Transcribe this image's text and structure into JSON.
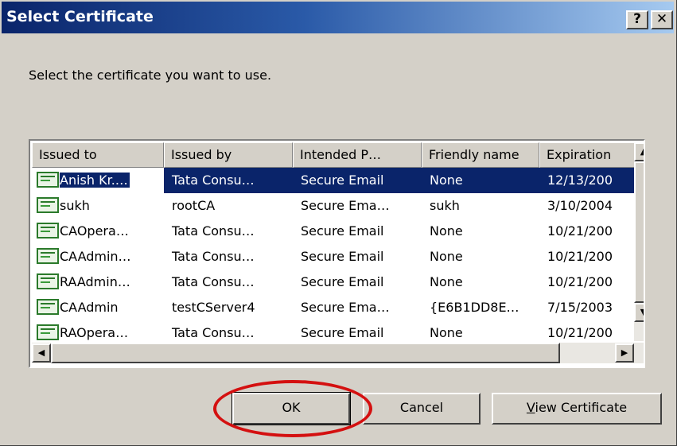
{
  "window": {
    "title": "Select Certificate",
    "help_label": "?",
    "close_label": "✕"
  },
  "prompt": "Select the certificate you want to use.",
  "list": {
    "headers": [
      "Issued to",
      "Issued by",
      "Intended P…",
      "Friendly name",
      "Expiration"
    ],
    "rows": [
      {
        "issued_to": "Anish Kr.…",
        "issued_by": "Tata Consu…",
        "intended": "Secure Email",
        "friendly": "None",
        "expiration": "12/13/200",
        "selected": true
      },
      {
        "issued_to": "sukh",
        "issued_by": "rootCA",
        "intended": "Secure Ema…",
        "friendly": "sukh",
        "expiration": "3/10/2004",
        "selected": false
      },
      {
        "issued_to": "CAOpera…",
        "issued_by": "Tata Consu…",
        "intended": "Secure Email",
        "friendly": "None",
        "expiration": "10/21/200",
        "selected": false
      },
      {
        "issued_to": "CAAdmin…",
        "issued_by": "Tata Consu…",
        "intended": "Secure Email",
        "friendly": "None",
        "expiration": "10/21/200",
        "selected": false
      },
      {
        "issued_to": "RAAdmin…",
        "issued_by": "Tata Consu…",
        "intended": "Secure Email",
        "friendly": "None",
        "expiration": "10/21/200",
        "selected": false
      },
      {
        "issued_to": "CAAdmin",
        "issued_by": "testCServer4",
        "intended": "Secure Ema…",
        "friendly": "{E6B1DD8E…",
        "expiration": "7/15/2003",
        "selected": false
      },
      {
        "issued_to": "RAOpera…",
        "issued_by": "Tata Consu…",
        "intended": "Secure Email",
        "friendly": "None",
        "expiration": "10/21/200",
        "selected": false
      }
    ],
    "row_icon": "certificate-icon"
  },
  "buttons": {
    "ok": "OK",
    "cancel": "Cancel",
    "view_prefix": "V",
    "view_rest": "iew Certificate"
  },
  "colors": {
    "selection": "#0a246a",
    "annotation": "#d41010",
    "dialog_face": "#d4d0c8"
  }
}
